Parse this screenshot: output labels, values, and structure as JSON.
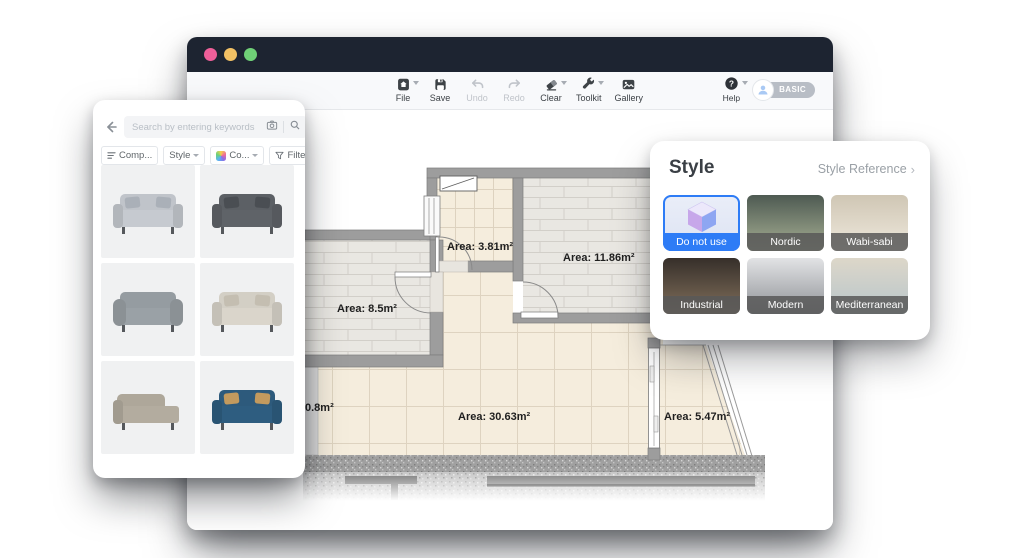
{
  "window": {
    "titlebar_color": "#1d2431",
    "traffic_lights": [
      "#ee5f99",
      "#f2c164",
      "#6fd077"
    ]
  },
  "toolbar": {
    "items": [
      {
        "label": "File",
        "icon": "file-icon",
        "caret": true,
        "disabled": false
      },
      {
        "label": "Save",
        "icon": "save-icon",
        "caret": false,
        "disabled": false
      },
      {
        "label": "Undo",
        "icon": "undo-icon",
        "caret": false,
        "disabled": true
      },
      {
        "label": "Redo",
        "icon": "redo-icon",
        "caret": false,
        "disabled": true
      },
      {
        "label": "Clear",
        "icon": "eraser-icon",
        "caret": true,
        "disabled": false
      },
      {
        "label": "Toolkit",
        "icon": "wrench-icon",
        "caret": true,
        "disabled": false
      },
      {
        "label": "Gallery",
        "icon": "gallery-icon",
        "caret": false,
        "disabled": false
      }
    ],
    "help": {
      "label": "Help",
      "icon_glyph": "?",
      "caret": true
    },
    "account": {
      "badge": "BASIC",
      "avatar_icon": "user-avatar-icon"
    }
  },
  "catalog_panel": {
    "search": {
      "placeholder": "Search by entering keywords",
      "icons": [
        "camera-icon",
        "magnifier-icon"
      ]
    },
    "view_icon": "grid-view-icon",
    "back_icon": "back-arrow-icon",
    "filters": [
      {
        "label": "Comp...",
        "icon": "list-lines-icon",
        "caret": false
      },
      {
        "label": "Style",
        "icon": "",
        "caret": true
      },
      {
        "label": "Co...",
        "icon": "color-swatch-icon",
        "caret": true
      },
      {
        "label": "Filters",
        "icon": "funnel-icon",
        "caret": false
      }
    ],
    "items": [
      {
        "name": "light-gray-sofa",
        "c": "#c6cad0",
        "p": "#aab0b8"
      },
      {
        "name": "dark-gray-sofa",
        "c": "#5f6368",
        "p": "#4a4e53"
      },
      {
        "name": "gray-loveseat",
        "c": "#9aa1a6",
        "p": "#858c91"
      },
      {
        "name": "cream-sofa",
        "c": "#dad5cb",
        "p": "#c4beb1"
      },
      {
        "name": "beige-chaise-sofa",
        "c": "#b3ac9f",
        "p": "#a19a8c"
      },
      {
        "name": "blue-fabric-sofa",
        "c": "#2e5d80",
        "p": "#c39a5e"
      }
    ]
  },
  "style_panel": {
    "title": "Style",
    "reference_label": "Style Reference",
    "reference_chevron": "›",
    "accent": "#2e7cf6",
    "options": [
      {
        "label": "Do not use",
        "selected": true,
        "thumb": [
          "#eaeef8",
          "#dde3f3"
        ]
      },
      {
        "label": "Nordic",
        "selected": false,
        "thumb": [
          "#4e5a52",
          "#a8b195"
        ]
      },
      {
        "label": "Wabi-sabi",
        "selected": false,
        "thumb": [
          "#cfc6b4",
          "#efe9dd"
        ]
      },
      {
        "label": "Industrial",
        "selected": false,
        "thumb": [
          "#362f2a",
          "#83715c"
        ]
      },
      {
        "label": "Modern",
        "selected": false,
        "thumb": [
          "#e2e3e5",
          "#8e9196"
        ]
      },
      {
        "label": "Mediterranean",
        "selected": false,
        "thumb": [
          "#ddd7c9",
          "#b7c5cb"
        ]
      }
    ]
  },
  "floor_plan": {
    "areas": {
      "room_small": "Area: 3.81m²",
      "room_right": "Area: 11.86m²",
      "room_left": "Area: 8.5m²",
      "living": "Area: 30.63m²",
      "balcony": "Area: 5.47m²",
      "partial": "0.8m²"
    }
  }
}
